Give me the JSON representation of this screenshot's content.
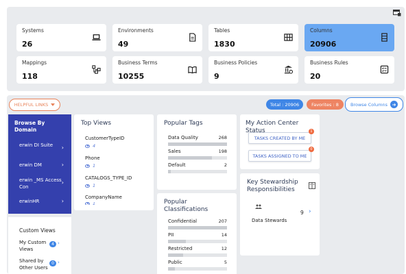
{
  "header": {
    "corner_icon": "grid-settings-icon"
  },
  "stats": [
    {
      "label": "Systems",
      "value": "26",
      "icon": "laptop-icon"
    },
    {
      "label": "Environments",
      "value": "49",
      "icon": "document-icon"
    },
    {
      "label": "Tables",
      "value": "1830",
      "icon": "table-icon"
    },
    {
      "label": "Columns",
      "value": "20906",
      "icon": "columns-icon"
    },
    {
      "label": "Mappings",
      "value": "118",
      "icon": "mapping-icon"
    },
    {
      "label": "Business Terms",
      "value": "10255",
      "icon": "book-icon"
    },
    {
      "label": "Business Policies",
      "value": "9",
      "icon": "policy-icon"
    },
    {
      "label": "Business Rules",
      "value": "20",
      "icon": "rules-icon"
    }
  ],
  "toolbar": {
    "helpful_links": "HELPFUL LINKS",
    "total": "Total : 20906",
    "favorites": "Favorites : 8",
    "browse_columns": "Browse Columns"
  },
  "domain": {
    "title": "Browse By Domain",
    "items": [
      "erwin DI Suite",
      "erwin DM",
      "erwin _MS Access Con",
      "erwinHR"
    ]
  },
  "custom_views": {
    "title": "Custom Views",
    "rows": [
      {
        "label": "My Custom Views",
        "count": "4"
      },
      {
        "label": "Shared by Other Users",
        "count": "0"
      }
    ]
  },
  "top_views": {
    "title": "Top Views",
    "items": [
      {
        "name": "CustomerTypeID",
        "count": "4"
      },
      {
        "name": "Phone",
        "count": "1"
      },
      {
        "name": "CATALOGS_TYPE_ID",
        "count": "1"
      },
      {
        "name": "CompanyName",
        "count": "1"
      }
    ]
  },
  "popular_tags": {
    "title": "Popular Tags",
    "items": [
      {
        "label": "Data Quality",
        "value": "268",
        "fill": 1.0
      },
      {
        "label": "Sales",
        "value": "198",
        "fill": 0.74
      },
      {
        "label": "Default",
        "value": "2",
        "fill": 0.05
      }
    ]
  },
  "popular_classifications": {
    "title": "Popular Classifications",
    "items": [
      {
        "label": "Confidential",
        "value": "207",
        "fill": 1.0
      },
      {
        "label": "PII",
        "value": "14",
        "fill": 0.3
      },
      {
        "label": "Restricted",
        "value": "12",
        "fill": 0.26
      },
      {
        "label": "Public",
        "value": "5",
        "fill": 0.12
      }
    ]
  },
  "action_center": {
    "title": "My Action Center Status",
    "tasks_created": "TASKS CREATED BY ME",
    "tasks_created_count": "1",
    "tasks_assigned": "TASKS ASSIGNED TO ME",
    "tasks_assigned_count": "0"
  },
  "stewardship": {
    "title": "Key Stewardship Responsibilities",
    "label": "Data Stewards",
    "count": "9"
  }
}
